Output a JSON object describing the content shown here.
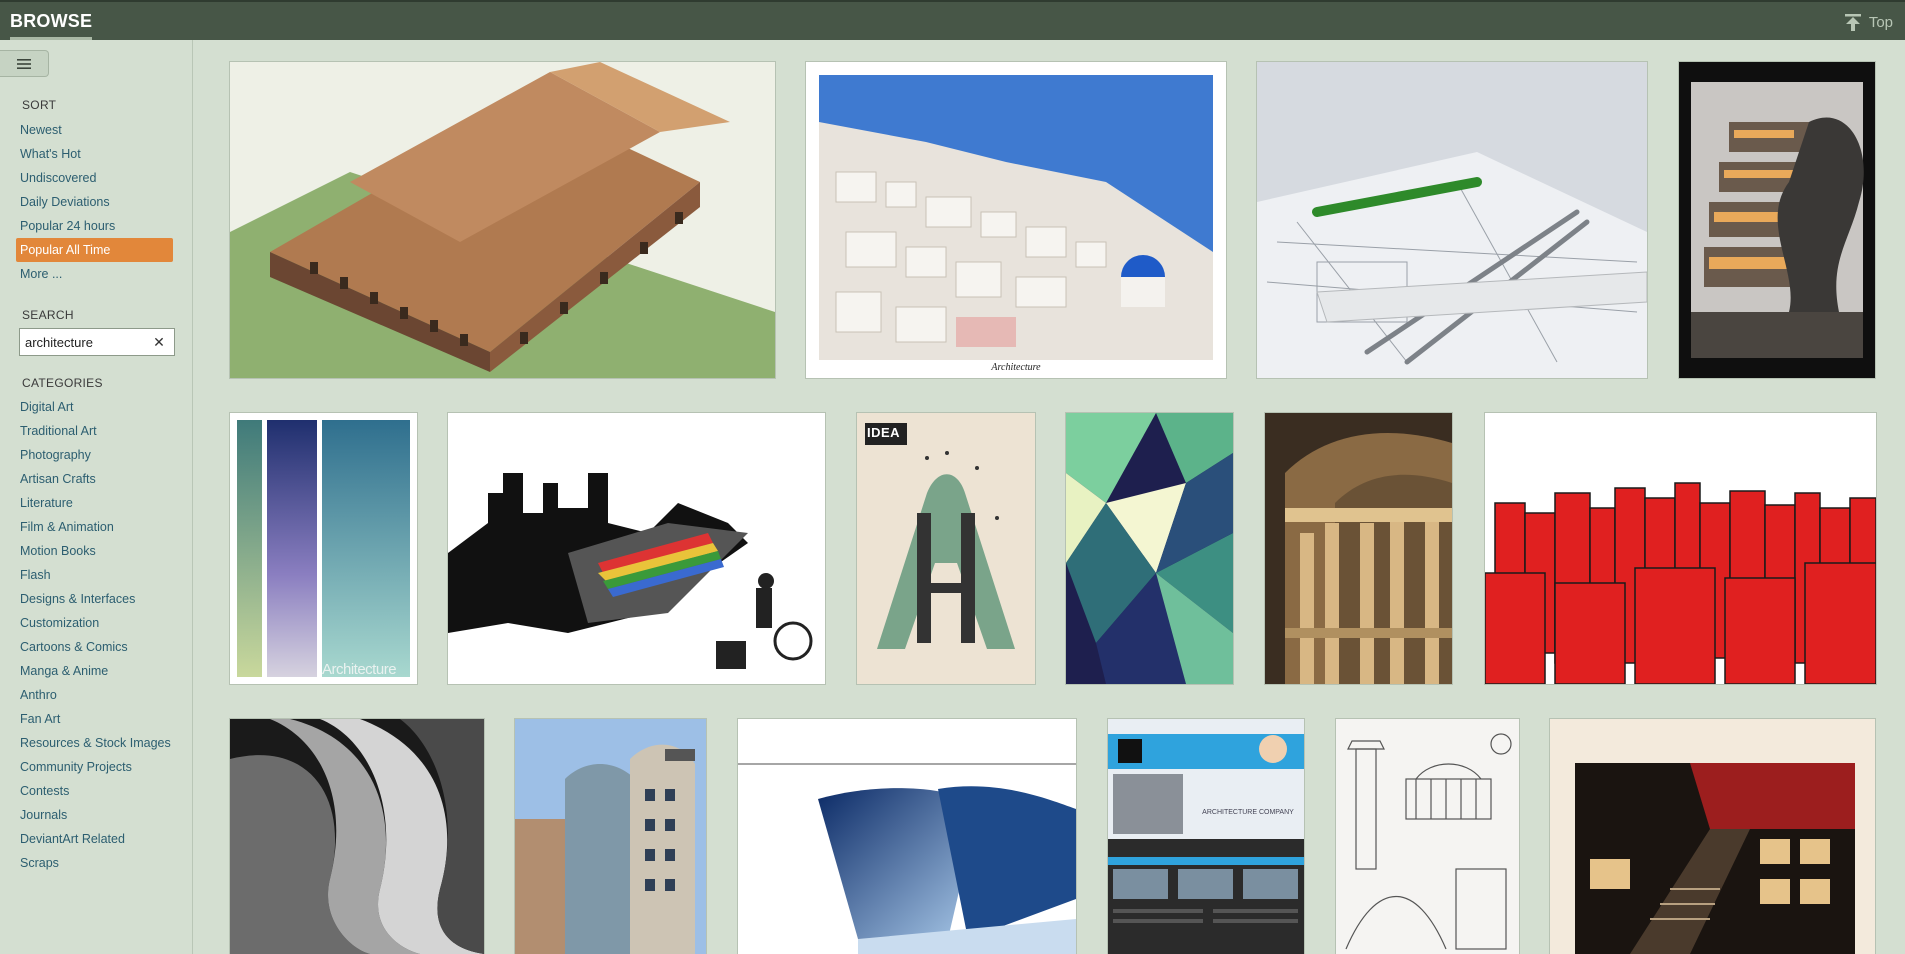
{
  "header": {
    "title": "BROWSE",
    "top_label": "Top"
  },
  "sidebar": {
    "sort_title": "SORT",
    "sort_items": [
      "Newest",
      "What's Hot",
      "Undiscovered",
      "Daily Deviations",
      "Popular 24 hours",
      "Popular All Time",
      "More ..."
    ],
    "active_sort": "Popular All Time",
    "search_title": "SEARCH",
    "search_value": "architecture",
    "categories_title": "CATEGORIES",
    "categories": [
      "Digital Art",
      "Traditional Art",
      "Photography",
      "Artisan Crafts",
      "Literature",
      "Film & Animation",
      "Motion Books",
      "Flash",
      "Designs & Interfaces",
      "Customization",
      "Cartoons & Comics",
      "Manga & Anime",
      "Anthro",
      "Fan Art",
      "Resources & Stock Images",
      "Community Projects",
      "Contests",
      "Journals",
      "DeviantArt Related",
      "Scraps"
    ]
  },
  "gallery": {
    "thumbnails": [
      {
        "caption": ""
      },
      {
        "caption": "Architecture"
      },
      {
        "caption": ""
      },
      {
        "caption": ""
      },
      {
        "caption": "Architecture"
      },
      {
        "caption": ""
      },
      {
        "caption": "IDEA"
      },
      {
        "caption": ""
      },
      {
        "caption": ""
      },
      {
        "caption": ""
      },
      {
        "caption": ""
      },
      {
        "caption": ""
      },
      {
        "caption": ""
      },
      {
        "caption": "ARCHITECTURE COMPANY"
      },
      {
        "caption": ""
      },
      {
        "caption": ""
      }
    ]
  }
}
